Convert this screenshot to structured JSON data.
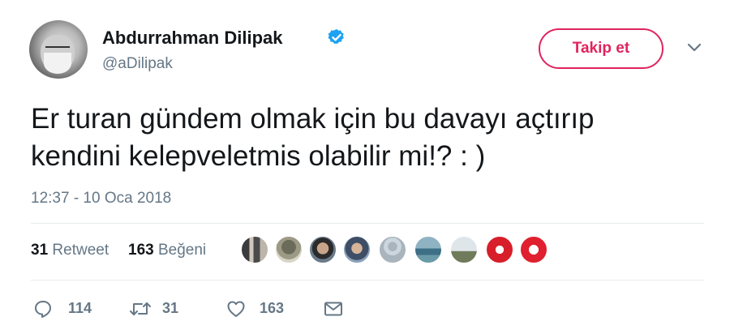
{
  "user": {
    "display_name": "Abdurrahman Dilipak",
    "handle": "@aDilipak",
    "verified": true
  },
  "follow_button": {
    "label": "Takip et"
  },
  "tweet": {
    "lines": [
      "Er turan gündem olmak için bu davayı açtırıp",
      "kendini kelepveletmis olabilir mi!? : )"
    ],
    "timestamp": "12:37 - 10 Oca 2018"
  },
  "stats": {
    "retweets_count": "31",
    "retweets_label": "Retweet",
    "likes_count": "163",
    "likes_label": "Beğeni"
  },
  "actions": {
    "reply_count": "114",
    "retweet_count": "31",
    "like_count": "163"
  },
  "colors": {
    "accent": "#e0245e",
    "verified_blue": "#1da1f2",
    "secondary_text": "#657786"
  }
}
